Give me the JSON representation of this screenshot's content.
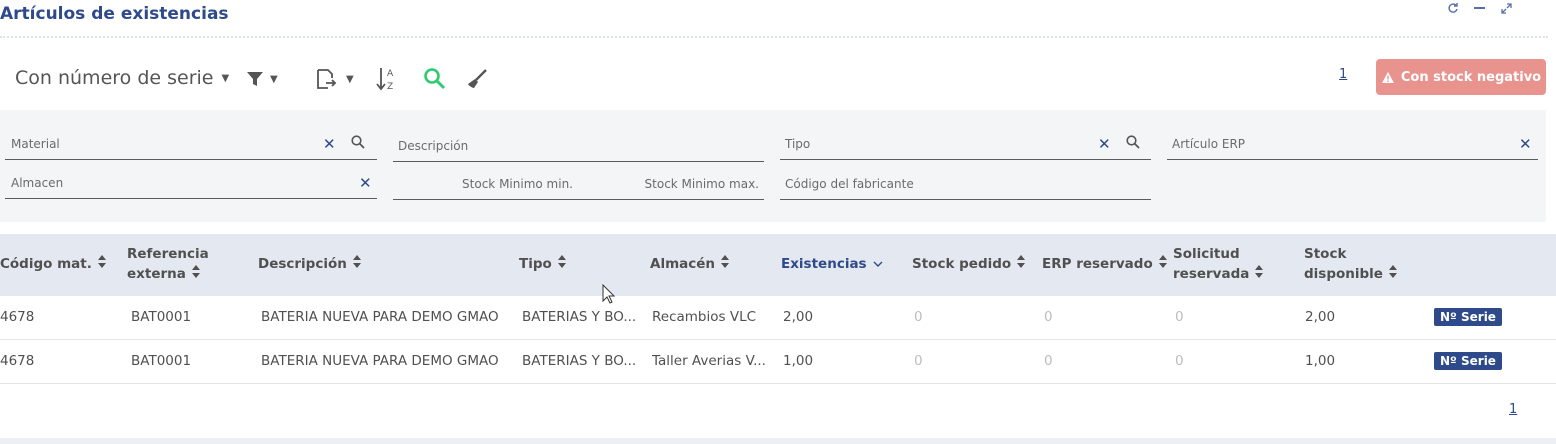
{
  "header": {
    "title": "Artículos de existencias"
  },
  "toolbar": {
    "view_label": "Con número de serie"
  },
  "pagination": {
    "top_page": "1",
    "bottom_page": "1"
  },
  "negative_stock_button": {
    "label": "Con stock negativo",
    "color": "#e8938d"
  },
  "filters": {
    "material": "Material",
    "descripcion": "Descripción",
    "tipo": "Tipo",
    "articulo_erp": "Artículo ERP",
    "almacen": "Almacen",
    "stock_min": "Stock Minimo min.",
    "stock_max": "Stock Minimo max.",
    "codigo_fabricante": "Código del fabricante"
  },
  "table": {
    "headers": {
      "codigo": "Código mat.",
      "referencia_1": "Referencia",
      "referencia_2": "externa",
      "descripcion": "Descripción",
      "tipo": "Tipo",
      "almacen": "Almacén",
      "existencias": "Existencias",
      "stock_pedido": "Stock pedido",
      "erp_reservado": "ERP reservado",
      "solicitud_1": "Solicitud",
      "solicitud_2": "reservada",
      "stock_disp_1": "Stock",
      "stock_disp_2": "disponible"
    },
    "rows": [
      {
        "codigo": "4678",
        "referencia": "BAT0001",
        "descripcion": "BATERIA NUEVA PARA DEMO GMAO",
        "tipo": "BATERIAS Y BO...",
        "almacen": "Recambios VLC",
        "existencias": "2,00",
        "stock_pedido": "0",
        "erp_reservado": "0",
        "solicitud": "0",
        "stock_disponible": "2,00",
        "badge": "Nº Serie"
      },
      {
        "codigo": "4678",
        "referencia": "BAT0001",
        "descripcion": "BATERIA NUEVA PARA DEMO GMAO",
        "tipo": "BATERIAS Y BO...",
        "almacen": "Taller Averias V...",
        "existencias": "1,00",
        "stock_pedido": "0",
        "erp_reservado": "0",
        "solicitud": "0",
        "stock_disponible": "1,00",
        "badge": "Nº Serie"
      }
    ]
  },
  "colors": {
    "accent": "#2e4a8a",
    "search_green": "#2ecc71",
    "header_bg": "#e4e9f1",
    "filter_bg": "#f4f5f7"
  }
}
